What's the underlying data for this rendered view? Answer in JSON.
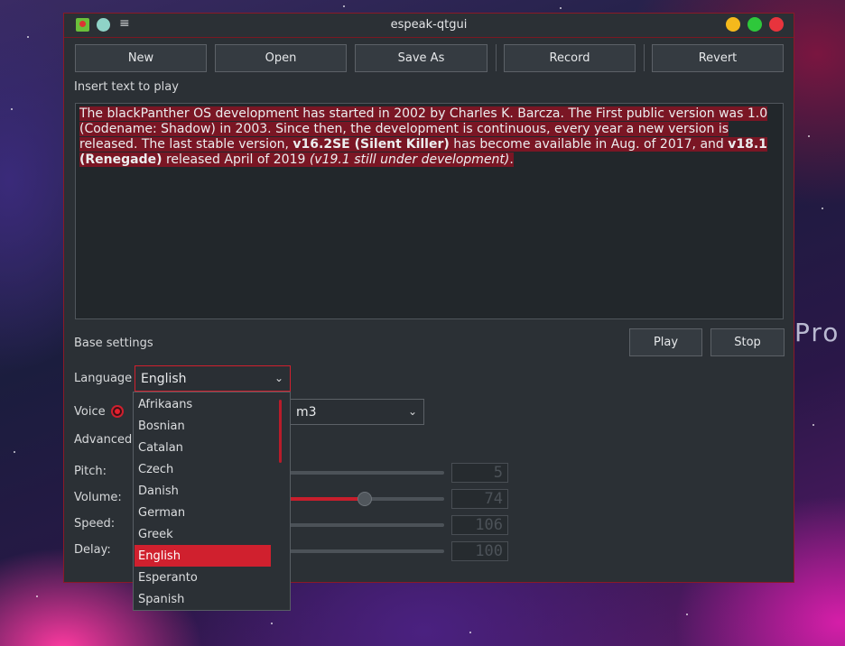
{
  "desktop": {
    "bg_text": "Pro"
  },
  "window": {
    "title": "espeak-qtgui",
    "menu_icon": "≡"
  },
  "toolbar": {
    "new_label": "New",
    "open_label": "Open",
    "save_as_label": "Save As",
    "record_label": "Record",
    "revert_label": "Revert"
  },
  "text_section": {
    "label": "Insert text to play",
    "p1": "The blackPanther OS development has started in 2002 by Charles K. Barcza. The First public version was 1.0 (Codename: Shadow) in 2003. Since then, the development is continuous, every year a new version is released. The last stable version,  ",
    "b1": "v16.2SE (Silent Killer)",
    "p2": " has become available in Aug. of 2017, and ",
    "b2": "v18.1 (Renegade)",
    "p3": " released April of 2019 ",
    "i1": "(v19.1 still under development)",
    "p4": "."
  },
  "base": {
    "label": "Base settings",
    "play_label": "Play",
    "stop_label": "Stop",
    "language_label": "Language",
    "language_value": "English",
    "voice_label": "Voice",
    "voice_value": "m3",
    "advanced_label": "Advanced s"
  },
  "sliders": [
    {
      "label": "Pitch:",
      "value": "5",
      "level": 0.05
    },
    {
      "label": "Volume:",
      "value": "74",
      "level": 0.74
    },
    {
      "label": "Speed:",
      "value": "106",
      "level": 0.25
    },
    {
      "label": "Delay:",
      "value": "100",
      "level": 0.05
    }
  ],
  "language_options": [
    "Afrikaans",
    "Bosnian",
    "Catalan",
    "Czech",
    "Danish",
    "German",
    "Greek",
    "English",
    "Esperanto",
    "Spanish"
  ],
  "selected_language": "English",
  "colors": {
    "accent": "#d0202e",
    "window_bg": "#2b3035",
    "text_highlight": "#7a1624"
  }
}
